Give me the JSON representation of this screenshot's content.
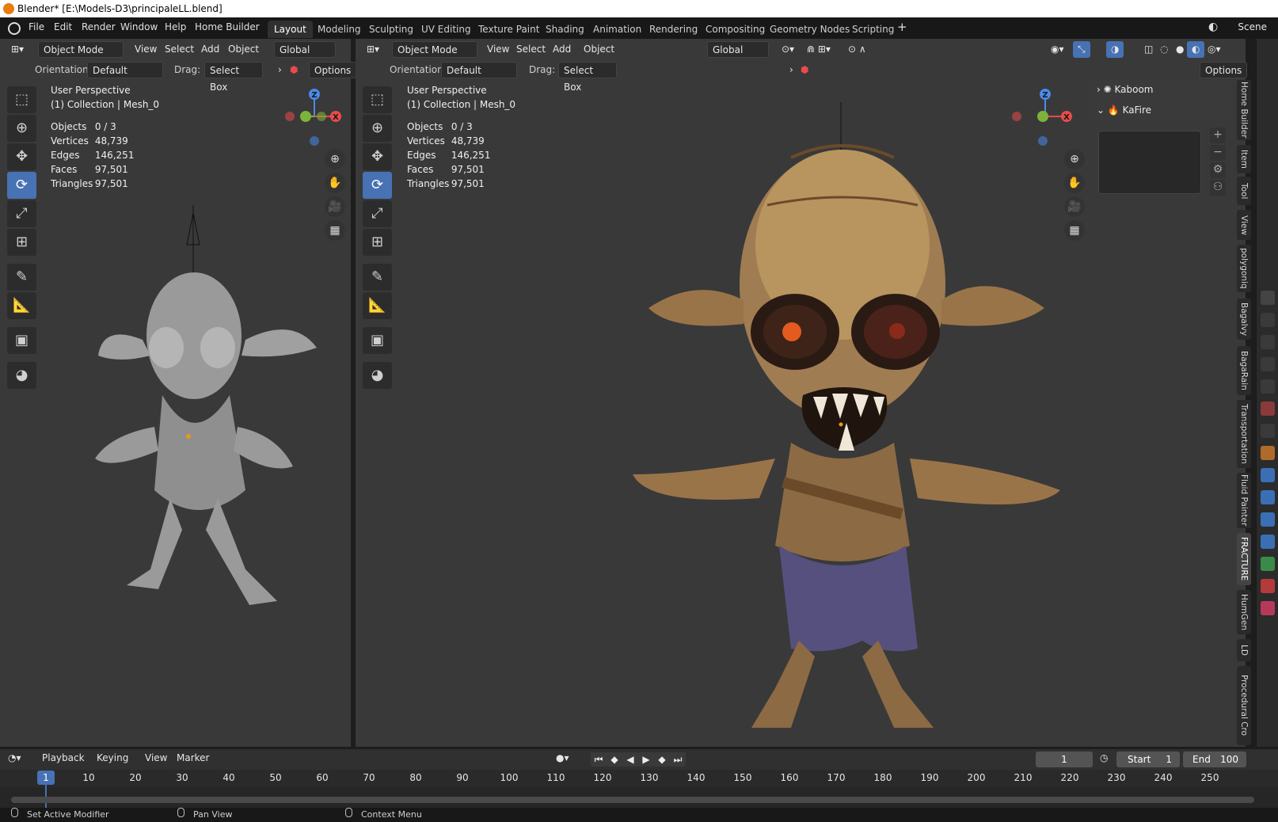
{
  "window": {
    "title": "Blender* [E:\\Models-D3\\principaleLL.blend]"
  },
  "menu": {
    "items": [
      "File",
      "Edit",
      "Render",
      "Window",
      "Help",
      "Home Builder"
    ]
  },
  "workspaces": [
    "Layout",
    "Modeling",
    "Sculpting",
    "UV Editing",
    "Texture Paint",
    "Shading",
    "Animation",
    "Rendering",
    "Compositing",
    "Geometry Nodes",
    "Scripting"
  ],
  "active_workspace": "Layout",
  "scene": "Scene",
  "viewport_left": {
    "mode": "Object Mode",
    "menus": [
      "View",
      "Select",
      "Add",
      "Object"
    ],
    "transform_orientation": "Global",
    "orientation_label": "Orientation:",
    "orientation_value": "Default",
    "drag_label": "Drag:",
    "drag_value": "Select Box",
    "options_label": "Options",
    "perspective": "User Perspective",
    "collection": "(1) Collection | Mesh_0",
    "stats": [
      {
        "k": "Objects",
        "v": "0 / 3"
      },
      {
        "k": "Vertices",
        "v": "48,739"
      },
      {
        "k": "Edges",
        "v": "146,251"
      },
      {
        "k": "Faces",
        "v": "97,501"
      },
      {
        "k": "Triangles",
        "v": "97,501"
      }
    ]
  },
  "viewport_right": {
    "mode": "Object Mode",
    "menus": [
      "View",
      "Select",
      "Add",
      "Object"
    ],
    "transform_orientation": "Global",
    "orientation_label": "Orientation:",
    "orientation_value": "Default",
    "drag_label": "Drag:",
    "drag_value": "Select Box",
    "options_label": "Options",
    "perspective": "User Perspective",
    "collection": "(1) Collection | Mesh_0",
    "stats": [
      {
        "k": "Objects",
        "v": "0 / 3"
      },
      {
        "k": "Vertices",
        "v": "48,739"
      },
      {
        "k": "Edges",
        "v": "146,251"
      },
      {
        "k": "Faces",
        "v": "97,501"
      },
      {
        "k": "Triangles",
        "v": "97,501"
      }
    ]
  },
  "gizmo_axes": {
    "z": "Z",
    "x": "X"
  },
  "sidebar_panels": [
    {
      "label": "Kaboom",
      "expanded": false
    },
    {
      "label": "KaFire",
      "expanded": true
    }
  ],
  "sidebar_tabs": [
    "Home Builder",
    "Item",
    "Tool",
    "View",
    "polygoniq",
    "Bagalvy",
    "BagaRain",
    "Transportation",
    "Fluid Painter",
    "FRACTURE",
    "HumGen",
    "LD",
    "Procedural Cro"
  ],
  "timeline": {
    "menus": [
      "Playback",
      "Keying",
      "View",
      "Marker"
    ],
    "current_frame": "1",
    "start_label": "Start",
    "start_value": "1",
    "end_label": "End",
    "end_value": "100",
    "ticks": [
      "1",
      "10",
      "20",
      "30",
      "40",
      "50",
      "60",
      "70",
      "80",
      "90",
      "100",
      "110",
      "120",
      "130",
      "140",
      "150",
      "160",
      "170",
      "180",
      "190",
      "200",
      "210",
      "220",
      "230",
      "240",
      "250"
    ]
  },
  "status": {
    "left": "Set Active Modifier",
    "middle": "Pan View",
    "right": "Context Menu"
  },
  "colors": {
    "accent": "#4772b3",
    "axis_x": "#e94b4b",
    "axis_y": "#7bb33b",
    "axis_z": "#4b8ae9"
  }
}
